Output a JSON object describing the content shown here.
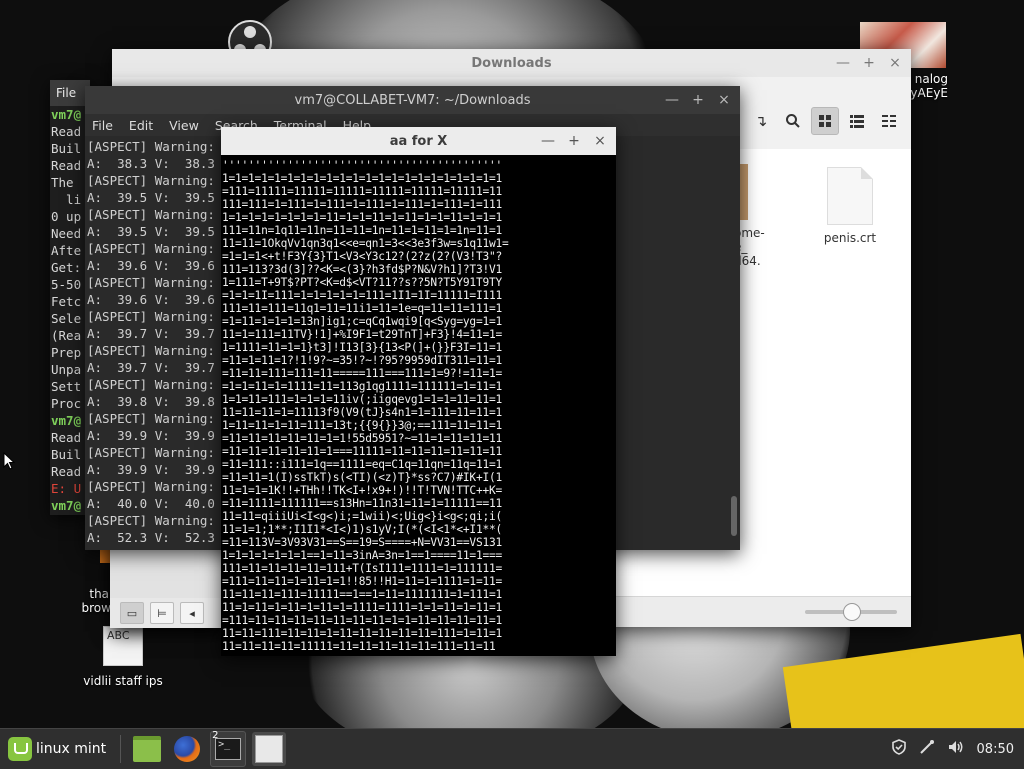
{
  "desktop": {
    "icons": [
      {
        "label": "than\nbrowse"
      },
      {
        "label": "vidlii staff ips",
        "thumb_text": "ABC"
      },
      {
        "label": "nalog\nyAEyE"
      }
    ]
  },
  "file_manager": {
    "title": "Downloads",
    "controls": [
      "—",
      "+",
      "×"
    ],
    "files": [
      {
        "name": "ome-\ne_\nd64."
      },
      {
        "name": "penis.crt"
      }
    ]
  },
  "back_terminal": {
    "menu_first": "File",
    "lines": [
      "vm7@",
      "Read",
      "Buil",
      "Read",
      "The ",
      "  li",
      "0 up",
      "Need",
      "Afte",
      "Get:",
      "5-50",
      "Fetc",
      "Sele",
      "(Rea",
      "Prep",
      "Unpa",
      "Sett",
      "Proc",
      "vm7@",
      "Read",
      "Buil",
      "Read",
      "E: U",
      "vm7@"
    ]
  },
  "terminal": {
    "title": "vm7@COLLABET-VM7: ~/Downloads",
    "menu": [
      "File",
      "Edit",
      "View",
      "Search",
      "Terminal",
      "Help"
    ],
    "lines": [
      "[ASPECT] Warning:",
      "A:  38.3 V:  38.3",
      "[ASPECT] Warning:",
      "A:  39.5 V:  39.5",
      "[ASPECT] Warning:",
      "A:  39.5 V:  39.5",
      "[ASPECT] Warning:",
      "A:  39.6 V:  39.6",
      "[ASPECT] Warning:",
      "A:  39.6 V:  39.6",
      "[ASPECT] Warning:",
      "A:  39.7 V:  39.7",
      "[ASPECT] Warning:",
      "A:  39.7 V:  39.7",
      "[ASPECT] Warning:",
      "A:  39.8 V:  39.8",
      "[ASPECT] Warning:",
      "A:  39.9 V:  39.9",
      "[ASPECT] Warning:",
      "A:  39.9 V:  39.9",
      "[ASPECT] Warning:",
      "A:  40.0 V:  40.0",
      "[ASPECT] Warning:",
      "A:  52.3 V:  52.3"
    ]
  },
  "aa_window": {
    "title": "aa for X",
    "lines": [
      "'''''''''''''''''''''''''''''''''''''''''''",
      "1=1=1=1=1=1=1=1=1=1=1=1=1=1=1=1=1=1=1=1=1=1",
      "=111=11111=11111=11111=11111=11111=11111=11",
      "111=111=1=111=1=111=1=111=1=111=1=111=1=111",
      "1=1=1=1=1=1=1=1=11=1=1=11=1=11=1=1=11=1=1=1",
      "111=11n=1q11=11n=11=11=1n=11=1=11=1=1n=11=1",
      "11=11=1OkqVv1qn3q1<<e=qn1=3<<3e3f3w=s1q11w1=",
      "=1=1=1<+t!F3Y{3}T1<V3<Y3c12?(2?z(2?(V3!T3\"?",
      "111=113?3d(3]??<K=<(3}?h3fd$P?N&V?h1]?T3!V1",
      "1=111=T+9T$?PT?<K=d$<VT?11??s??5N?T5Y91T9TY",
      "=1=1=1I=111=1=1=1=1=1=111=1I1=1I=11111=I111",
      "111=11=111=11q1=11=11i1=11=1e=q=11=11=111=1",
      "=1=11=1=1=1=13n]ig1;c=qCq1wqi9[q<Syg=yg=1=1",
      "11=1=111=11TV}!1]+%I9F1=t29TnT]+F3}!4=11=1=",
      "1=1111=11=1=1}t3]!I13[3}{13<P(]+(}}F3I=11=1",
      "=11=1=11=1?!1!9?~=35!?~!?95?9959dIT311=11=1",
      "=11=11=111=111=11=====111===111=1=9?!=11=1=",
      "=1=1=11=1=1111=11=113g1qg1111=111111=1=11=1",
      "1=1=11=111=1=1=1=11iv(;iigqevg1=1=1=11=11=1",
      "11=11=11=1=11113f9(V9(tJ}s4n1=1=111=11=11=1",
      "1=11=11=1=11=111=13t;{{9{}}3@;==111=11=11=1",
      "=11=11=11=11=11=1=1!55d5951?~=11=1=11=11=11",
      "=11=11=11=11=11=1===11111=11=11=11=11=11=11",
      "=11=111::i111=1q==1111=eq=C1q=11qn=11q=11=1",
      "=11=11=1(I)ssTkT)s(<TI)(<z)T}*ss?C7)#IK+I(1",
      "11=1=1=1K!!+THh!!TK<I+!x9+!)!!T!TVN!TTC++K=",
      "=11=1111=111111==s13Hn=11n31=11=1=11111==11",
      "11=11=qiiiUi<I<g<)i;=1wii)<;Uig<}i<g<;qi;i(",
      "11=1=1;1**;I1I1*<I<)1)s1yV;I(*(<I<1*<+I1**(",
      "=11=113V=3V93V31==S==19=S====+N=VV31==VS131",
      "1=1=1=1=1=1=1==1=11=3inA=3n=1==1====11=1===",
      "111=11=11=11=11=111+T(IsI111=1111=1=111111=",
      "=111=11=11=1=11=1=1!!85!!H1=11=1=1111=1=11=",
      "11=11=11=111=11111==1==1=11=1111111=1=111=1",
      "11=1=11=1=11=1=11=1=1111=1111=1=1=11=1=11=1",
      "=111=11=11=11=11=11=11=11=1=1=11=11=11=11=1",
      "11=11=111=11=11=1=11=11=11=11=11=111=1=11=1",
      "11=11=11=11=11111=11=11=11=11=11=111=11=11"
    ]
  },
  "taskbar": {
    "menu_label": "linux mint",
    "terminal_badge": "2",
    "clock": "08:50"
  }
}
